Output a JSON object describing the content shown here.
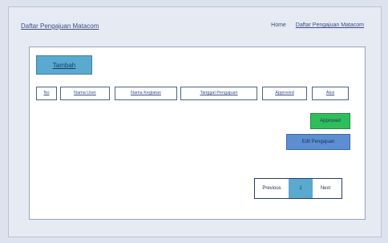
{
  "header": {
    "title": "Daftar Pengajuan Matacom",
    "breadcrumb": [
      "Home",
      "Daftar Pengajuan Matacom"
    ]
  },
  "panel": {
    "add_button": "Tambah",
    "table_headers": [
      "No",
      "Nama User",
      "Nama Kegiatan",
      "Tanggal Pengajuan",
      "Approved",
      "Aksi"
    ],
    "approve_button": "Approved",
    "edit_button": "Edit Pengajuan",
    "pagination": {
      "previous": "Previous",
      "current_page": "1",
      "next": "Next"
    }
  },
  "colors": {
    "add_button": "#5aa9cf",
    "approve_button": "#2fbf5a",
    "edit_button": "#5c8fd1"
  }
}
